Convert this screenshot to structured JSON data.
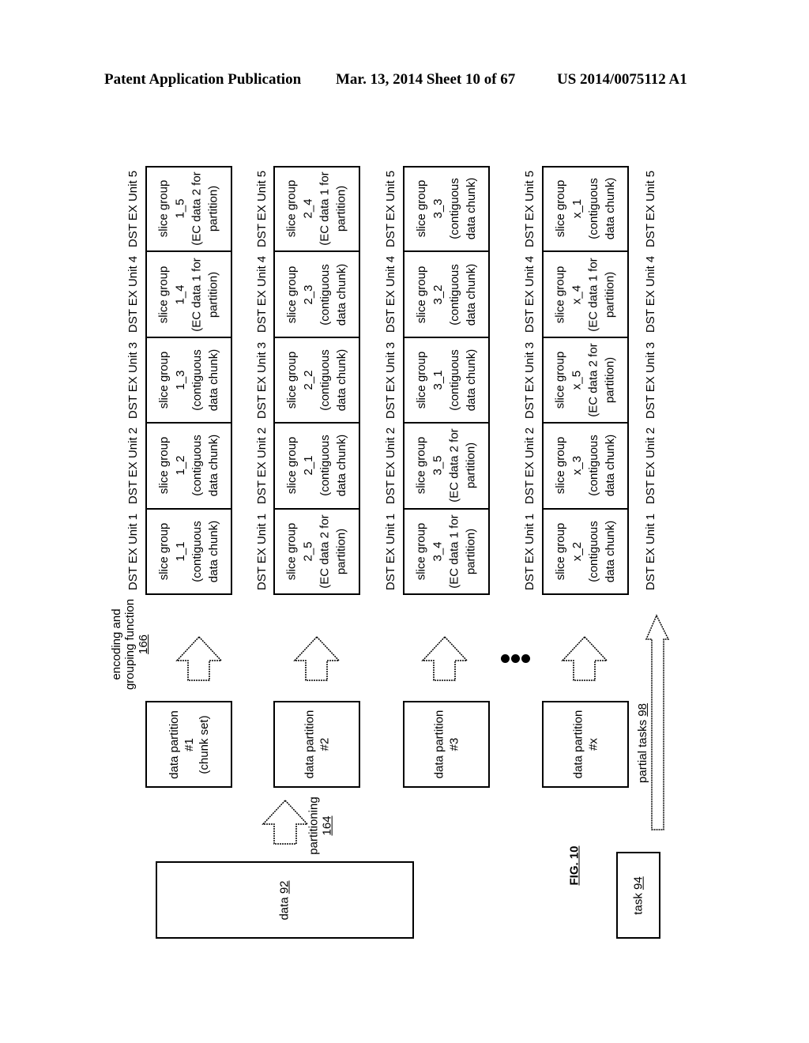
{
  "header": {
    "left": "Patent Application Publication",
    "middle": "Mar. 13, 2014  Sheet 10 of 67",
    "right": "US 2014/0075112 A1"
  },
  "figure": {
    "label": "FIG. 10",
    "data": {
      "text": "data",
      "ref": "92"
    },
    "task": {
      "text": "task",
      "ref": "94"
    },
    "partitioning": {
      "text": "partitioning",
      "ref": "164"
    },
    "encoding": {
      "line1": "encoding and",
      "line2": "grouping function",
      "ref": "166"
    },
    "partial_tasks": {
      "text": "partial tasks",
      "ref": "98"
    },
    "ellipsis": "•••",
    "unit_labels": [
      "DST EX Unit 1",
      "DST EX Unit 2",
      "DST EX Unit 3",
      "DST EX Unit 4",
      "DST EX Unit 5"
    ],
    "partitions": [
      {
        "line1": "data partition",
        "line2": "#1",
        "line3": "(chunk set)",
        "slices": [
          {
            "unit": "DST EX Unit 1",
            "l1": "slice group",
            "l2": "1_1",
            "l3": "(contiguous",
            "l4": "data chunk)"
          },
          {
            "unit": "DST EX Unit 2",
            "l1": "slice group",
            "l2": "1_2",
            "l3": "(contiguous",
            "l4": "data chunk)"
          },
          {
            "unit": "DST EX Unit 3",
            "l1": "slice group",
            "l2": "1_3",
            "l3": "(contiguous",
            "l4": "data chunk)"
          },
          {
            "unit": "DST EX Unit 4",
            "l1": "slice group",
            "l2": "1_4",
            "l3": "(EC data 1 for",
            "l4": "partition)"
          },
          {
            "unit": "DST EX Unit 5",
            "l1": "slice group",
            "l2": "1_5",
            "l3": "(EC data 2 for",
            "l4": "partition)"
          }
        ]
      },
      {
        "line1": "data partition",
        "line2": "#2",
        "line3": "",
        "slices": [
          {
            "unit": "DST EX Unit 1",
            "l1": "slice group",
            "l2": "2_5",
            "l3": "(EC data 2 for",
            "l4": "partition)"
          },
          {
            "unit": "DST EX Unit 2",
            "l1": "slice group",
            "l2": "2_1",
            "l3": "(contiguous",
            "l4": "data chunk)"
          },
          {
            "unit": "DST EX Unit 3",
            "l1": "slice group",
            "l2": "2_2",
            "l3": "(contiguous",
            "l4": "data chunk)"
          },
          {
            "unit": "DST EX Unit 4",
            "l1": "slice group",
            "l2": "2_3",
            "l3": "(contiguous",
            "l4": "data chunk)"
          },
          {
            "unit": "DST EX Unit 5",
            "l1": "slice group",
            "l2": "2_4",
            "l3": "(EC data 1 for",
            "l4": "partition)"
          }
        ]
      },
      {
        "line1": "data partition",
        "line2": "#3",
        "line3": "",
        "slices": [
          {
            "unit": "DST EX Unit 1",
            "l1": "slice group",
            "l2": "3_4",
            "l3": "(EC data 1 for",
            "l4": "partition)"
          },
          {
            "unit": "DST EX Unit 2",
            "l1": "slice group",
            "l2": "3_5",
            "l3": "(EC data 2 for",
            "l4": "partition)"
          },
          {
            "unit": "DST EX Unit 3",
            "l1": "slice group",
            "l2": "3_1",
            "l3": "(contiguous",
            "l4": "data chunk)"
          },
          {
            "unit": "DST EX Unit 4",
            "l1": "slice group",
            "l2": "3_2",
            "l3": "(contiguous",
            "l4": "data chunk)"
          },
          {
            "unit": "DST EX Unit 5",
            "l1": "slice group",
            "l2": "3_3",
            "l3": "(contiguous",
            "l4": "data chunk)"
          }
        ]
      },
      {
        "line1": "data partition",
        "line2": "#x",
        "line3": "",
        "slices": [
          {
            "unit": "DST EX Unit 1",
            "l1": "slice group",
            "l2": "x_2",
            "l3": "(contiguous",
            "l4": "data chunk)"
          },
          {
            "unit": "DST EX Unit 2",
            "l1": "slice group",
            "l2": "x_3",
            "l3": "(contiguous",
            "l4": "data chunk)"
          },
          {
            "unit": "DST EX Unit 3",
            "l1": "slice group",
            "l2": "x_5",
            "l3": "(EC data 2 for",
            "l4": "partition)"
          },
          {
            "unit": "DST EX Unit 4",
            "l1": "slice group",
            "l2": "x_4",
            "l3": "(EC data 1 for",
            "l4": "partition)"
          },
          {
            "unit": "DST EX Unit 5",
            "l1": "slice group",
            "l2": "x_1",
            "l3": "(contiguous",
            "l4": "data chunk)"
          }
        ]
      }
    ]
  }
}
